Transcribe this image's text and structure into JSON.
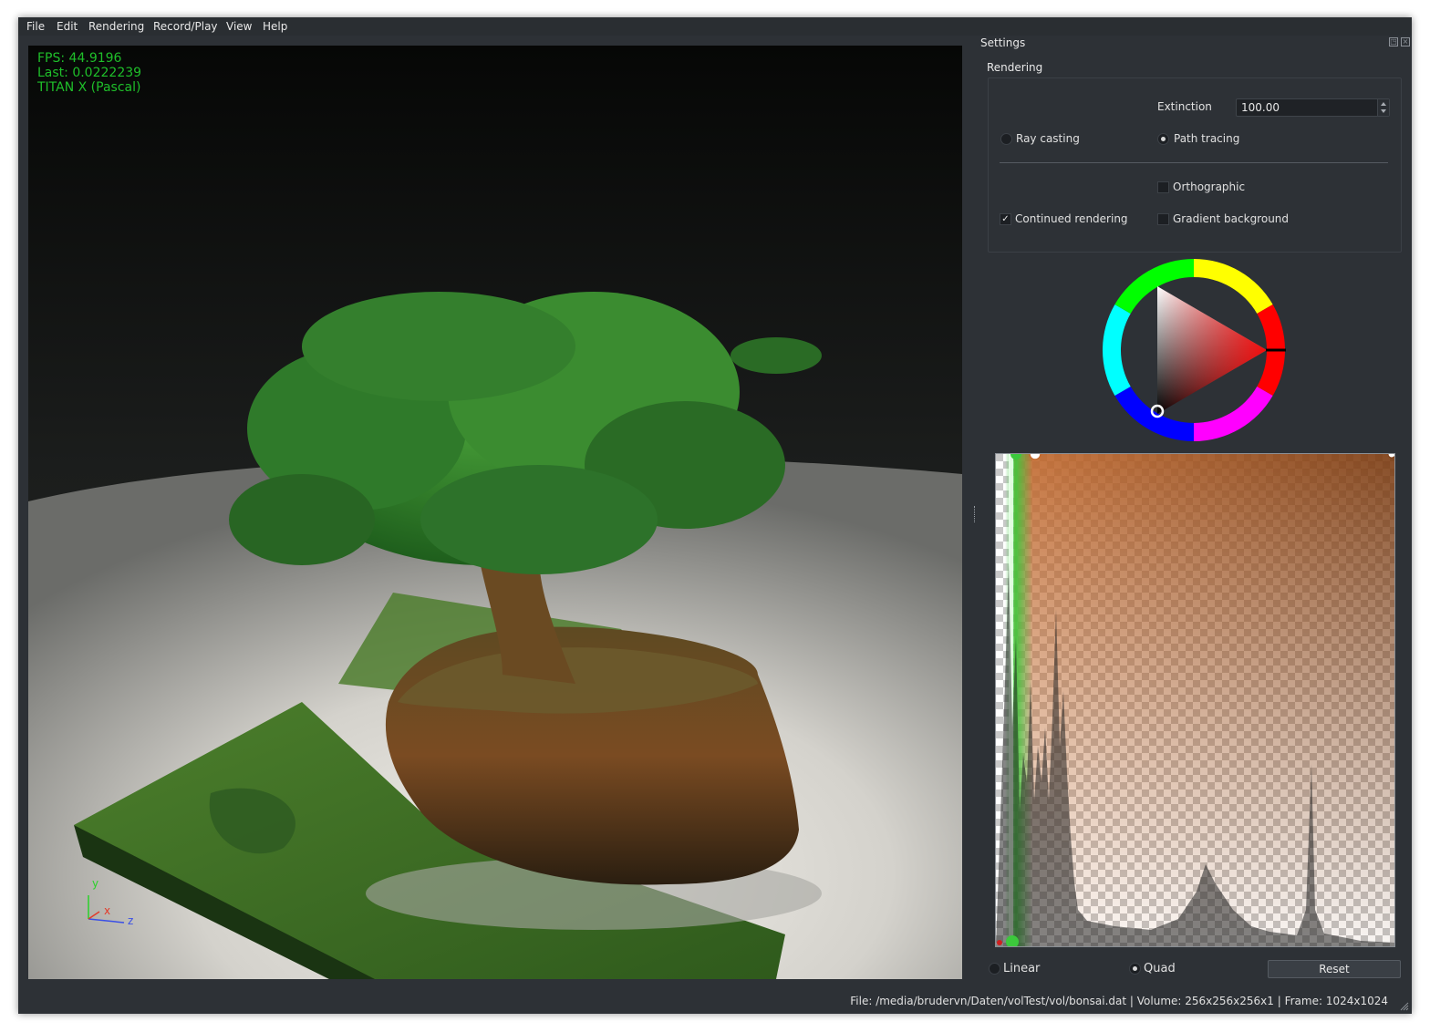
{
  "menubar": {
    "items": [
      "File",
      "Edit",
      "Rendering",
      "Record/Play",
      "View",
      "Help"
    ]
  },
  "viewport": {
    "overlay": {
      "fps": "FPS: 44.9196",
      "last": "Last: 0.0222239",
      "gpu": "TITAN X (Pascal)"
    },
    "axes": {
      "y": "y",
      "x": "x",
      "z": "z"
    },
    "colors": {
      "axis_y": "#2ad12a",
      "axis_x": "#e23a2a",
      "axis_z": "#3a4fe6",
      "overlay_text": "#1fbf2a"
    }
  },
  "settings": {
    "title": "Settings",
    "rendering_group": {
      "title": "Rendering",
      "extinction_label": "Extinction",
      "extinction_value": "100.00",
      "ray_casting_label": "Ray casting",
      "ray_casting_selected": false,
      "path_tracing_label": "Path tracing",
      "path_tracing_selected": true,
      "orthographic_label": "Orthographic",
      "orthographic_checked": false,
      "continued_rendering_label": "Continued rendering",
      "continued_rendering_checked": true,
      "gradient_background_label": "Gradient background",
      "gradient_background_checked": false
    },
    "color_picker": {
      "hue_color": "#ff0000",
      "selected_color": "#000000"
    },
    "transfer_function": {
      "mode_linear_label": "Linear",
      "mode_linear_selected": false,
      "mode_quad_label": "Quad",
      "mode_quad_selected": true,
      "reset_label": "Reset",
      "colors": {
        "control_point_green": "#3cc93c",
        "ramp_start": "#c46a2e",
        "ramp_end": "#7a3a10"
      }
    }
  },
  "status": {
    "text": "File: /media/brudervn/Daten/volTest/vol/bonsai.dat | Volume: 256x256x256x1 | Frame: 1024x1024"
  }
}
